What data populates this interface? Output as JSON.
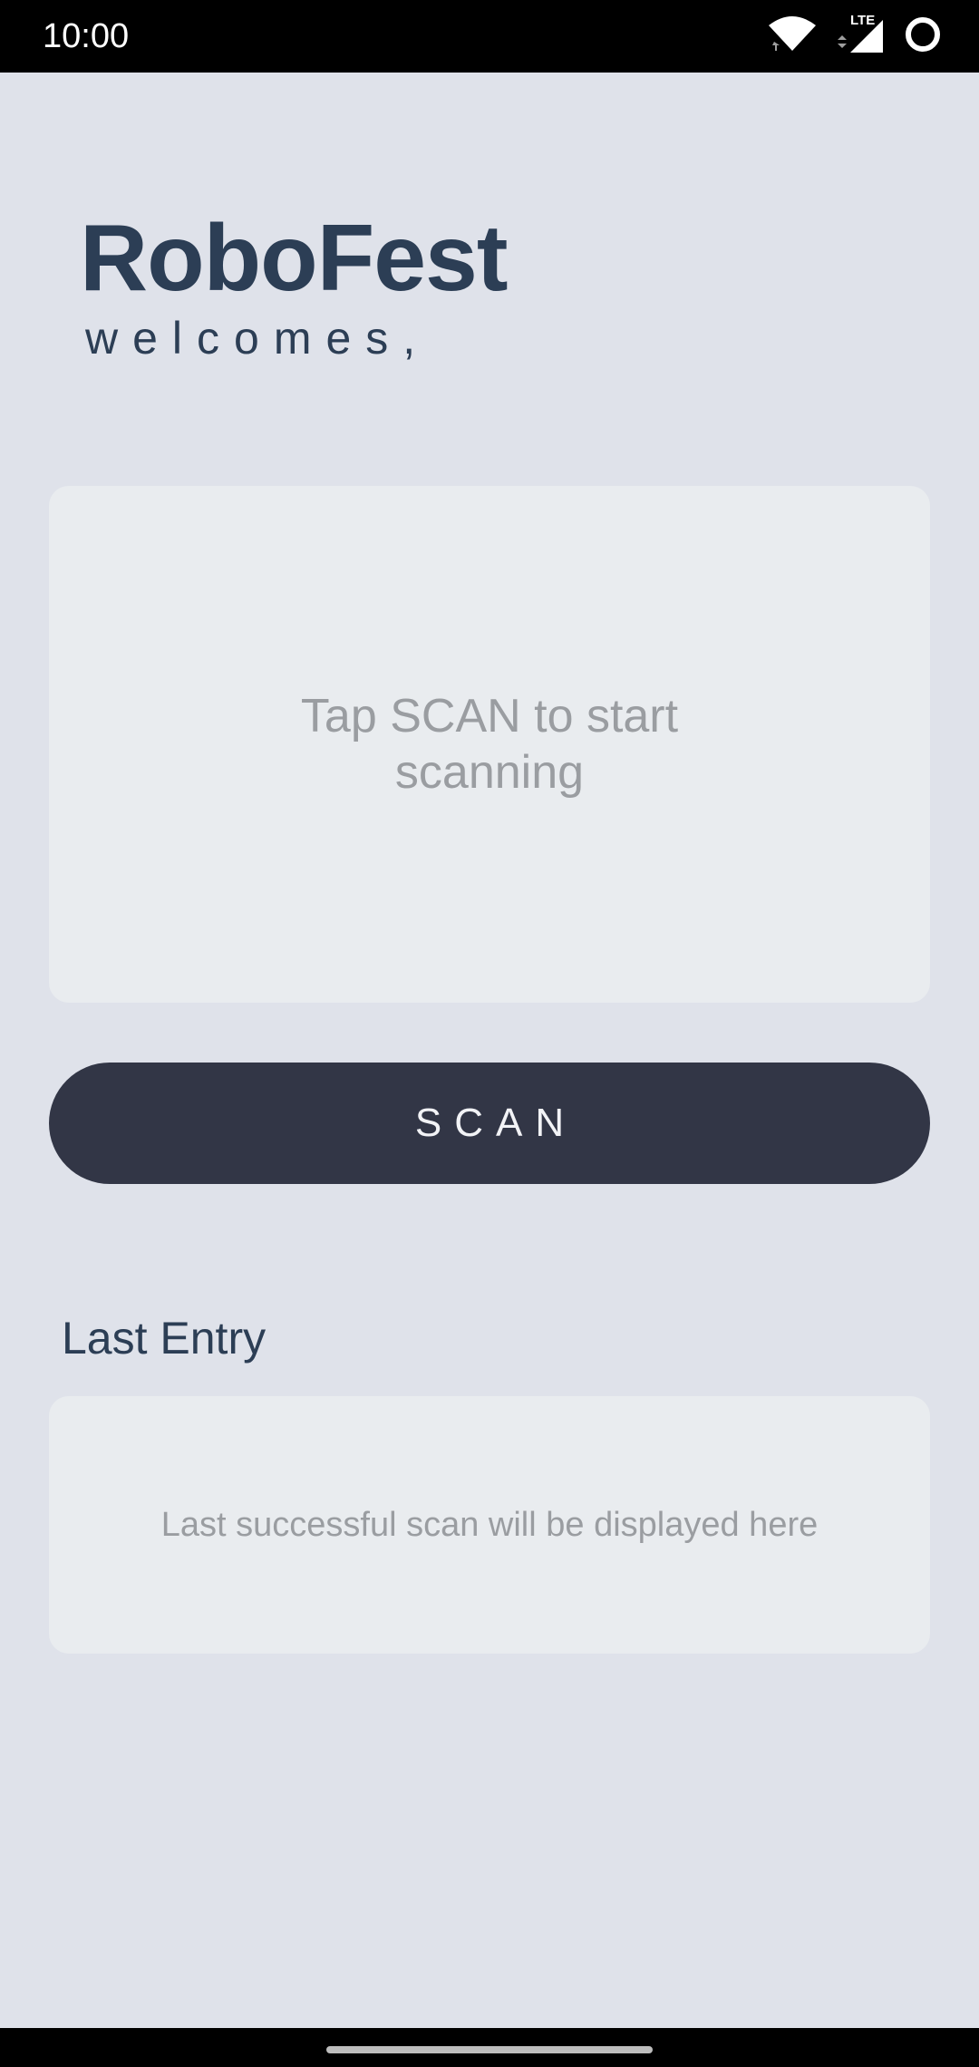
{
  "status_bar": {
    "time": "10:00",
    "network_label": "LTE",
    "icons": [
      "wifi-icon",
      "cell-signal-icon",
      "battery-circle-icon"
    ]
  },
  "header": {
    "title": "RoboFest",
    "subtitle": "welcomes,"
  },
  "scanner": {
    "hint": "Tap SCAN to start scanning",
    "button_label": "SCAN"
  },
  "last_entry": {
    "heading": "Last Entry",
    "placeholder": "Last successful scan will be displayed here"
  },
  "colors": {
    "background": "#dfe2ea",
    "card": "#e9ecef",
    "title_text": "#2c3e55",
    "button": "#323646",
    "hint_text": "#9a9da1"
  }
}
